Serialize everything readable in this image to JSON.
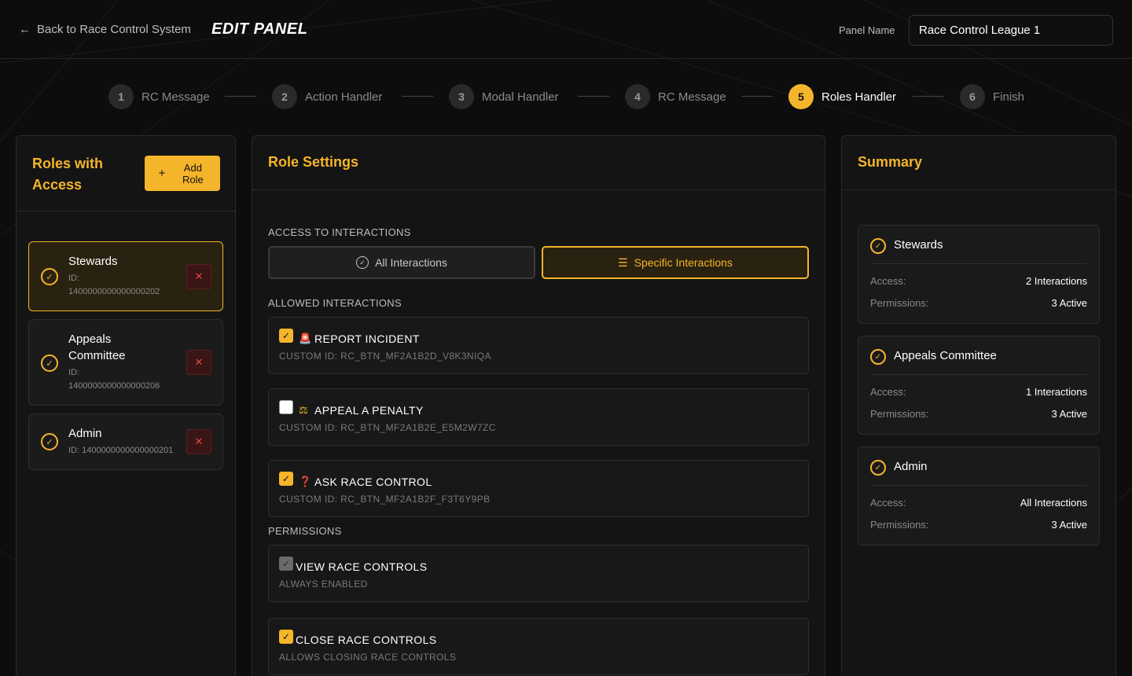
{
  "header": {
    "back_label": "Back to Race Control System",
    "title": "EDIT PANEL",
    "panel_name_label": "Panel Name",
    "panel_name_value": "Race Control League 1"
  },
  "steps": [
    {
      "num": "1",
      "label": "RC Message",
      "active": false
    },
    {
      "num": "2",
      "label": "Action Handler",
      "active": false
    },
    {
      "num": "3",
      "label": "Modal Handler",
      "active": false
    },
    {
      "num": "4",
      "label": "RC Message",
      "active": false
    },
    {
      "num": "5",
      "label": "Roles Handler",
      "active": true
    },
    {
      "num": "6",
      "label": "Finish",
      "active": false
    }
  ],
  "roles_panel": {
    "title": "Roles with Access",
    "add_button": "Add Role",
    "roles": [
      {
        "name": "Stewards",
        "id_label": "ID:",
        "id": "1400000000000000202",
        "selected": true
      },
      {
        "name": "Appeals Committee",
        "id_label": "ID:",
        "id": "1400000000000000206",
        "selected": false
      },
      {
        "name": "Admin",
        "id_label": "ID:",
        "id": "1400000000000000201",
        "selected": false
      }
    ]
  },
  "settings_panel": {
    "title": "Role Settings",
    "access_label": "ACCESS TO INTERACTIONS",
    "all_interactions": "All Interactions",
    "specific_interactions": "Specific Interactions",
    "allowed_label": "ALLOWED INTERACTIONS",
    "interactions": [
      {
        "emoji": "🚨",
        "title": "REPORT INCIDENT",
        "sub": "CUSTOM ID: RC_BTN_MF2A1B2D_V8K3NIQA",
        "checked": true
      },
      {
        "emoji": "⚖",
        "title": "APPEAL A PENALTY",
        "sub": "CUSTOM ID: RC_BTN_MF2A1B2E_E5M2W7ZC",
        "checked": false
      },
      {
        "emoji": "❓",
        "title": "ASK RACE CONTROL",
        "sub": "CUSTOM ID: RC_BTN_MF2A1B2F_F3T6Y9PB",
        "checked": true
      }
    ],
    "permissions_label": "PERMISSIONS",
    "permissions": [
      {
        "title": "VIEW RACE CONTROLS",
        "sub": "ALWAYS ENABLED",
        "state": "disabled"
      },
      {
        "title": "CLOSE RACE CONTROLS",
        "sub": "ALLOWS CLOSING RACE CONTROLS",
        "state": "checked"
      }
    ]
  },
  "summary_panel": {
    "title": "Summary",
    "access_key": "Access:",
    "permissions_key": "Permissions:",
    "items": [
      {
        "name": "Stewards",
        "access": "2 Interactions",
        "permissions": "3 Active"
      },
      {
        "name": "Appeals Committee",
        "access": "1 Interactions",
        "permissions": "3 Active"
      },
      {
        "name": "Admin",
        "access": "All Interactions",
        "permissions": "3 Active"
      }
    ]
  },
  "colors": {
    "accent": "#f5b52a",
    "background": "#0d0d0d",
    "panel": "#141414",
    "danger": "#e04848"
  }
}
